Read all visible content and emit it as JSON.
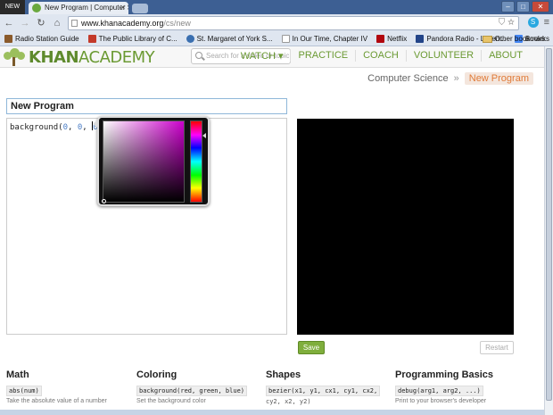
{
  "browser": {
    "os_badge": "NEW",
    "tab_title": "New Program | Computer Sc",
    "url_host": "www.khanacademy.org",
    "url_path": "/cs/new",
    "bookmarks": [
      {
        "label": "Radio Station Guide",
        "color": "#8a5a2b"
      },
      {
        "label": "The Public Library of C...",
        "color": "#c33a2a"
      },
      {
        "label": "St. Margaret of York S...",
        "color": "#3a6fb0"
      },
      {
        "label": "In Our Time, Chapter IV",
        "color": "#ffffff"
      },
      {
        "label": "Netflix",
        "color": "#b1060f"
      },
      {
        "label": "Pandora Radio - Listen...",
        "color": "#224488"
      },
      {
        "label": "Books",
        "color": "#4285f4"
      }
    ],
    "bookmarks_overflow": "»",
    "other_bookmarks": "Other bookmarks"
  },
  "header": {
    "logo_khan": "KHAN",
    "logo_academy": "ACADEMY",
    "search_placeholder": "Search for a video or topic",
    "nav": [
      "WATCH ▾",
      "PRACTICE",
      "COACH",
      "VOLUNTEER",
      "ABOUT"
    ]
  },
  "breadcrumb": {
    "parent": "Computer Science",
    "separator": "»",
    "current": "New Program"
  },
  "program": {
    "title": "New Program",
    "code_fn": "background(",
    "code_arg1": "0",
    "code_arg2": "0",
    "code_arg3": "0",
    "code_close": ");"
  },
  "controls": {
    "save": "Save",
    "restart": "Restart"
  },
  "docs": [
    {
      "heading": "Math",
      "sig": "abs(num)",
      "sig2": "",
      "desc": "Take the absolute value of a number"
    },
    {
      "heading": "Coloring",
      "sig": "background(red, green, blue)",
      "sig2": "",
      "desc": "Set the background color"
    },
    {
      "heading": "Shapes",
      "sig": "bezier(x1, y1, cx1, cy1, cx2,",
      "sig2": "cy2, x2, y2)",
      "desc": ""
    },
    {
      "heading": "Programming Basics",
      "sig": "debug(arg1, arg2, ...)",
      "sig2": "",
      "desc": "Print to your browser's developer"
    }
  ],
  "colors": {
    "ka_green": "#6b9a33",
    "save_green": "#7fae3c",
    "breadcrumb_orange": "#e07b39",
    "canvas": "#000000"
  }
}
